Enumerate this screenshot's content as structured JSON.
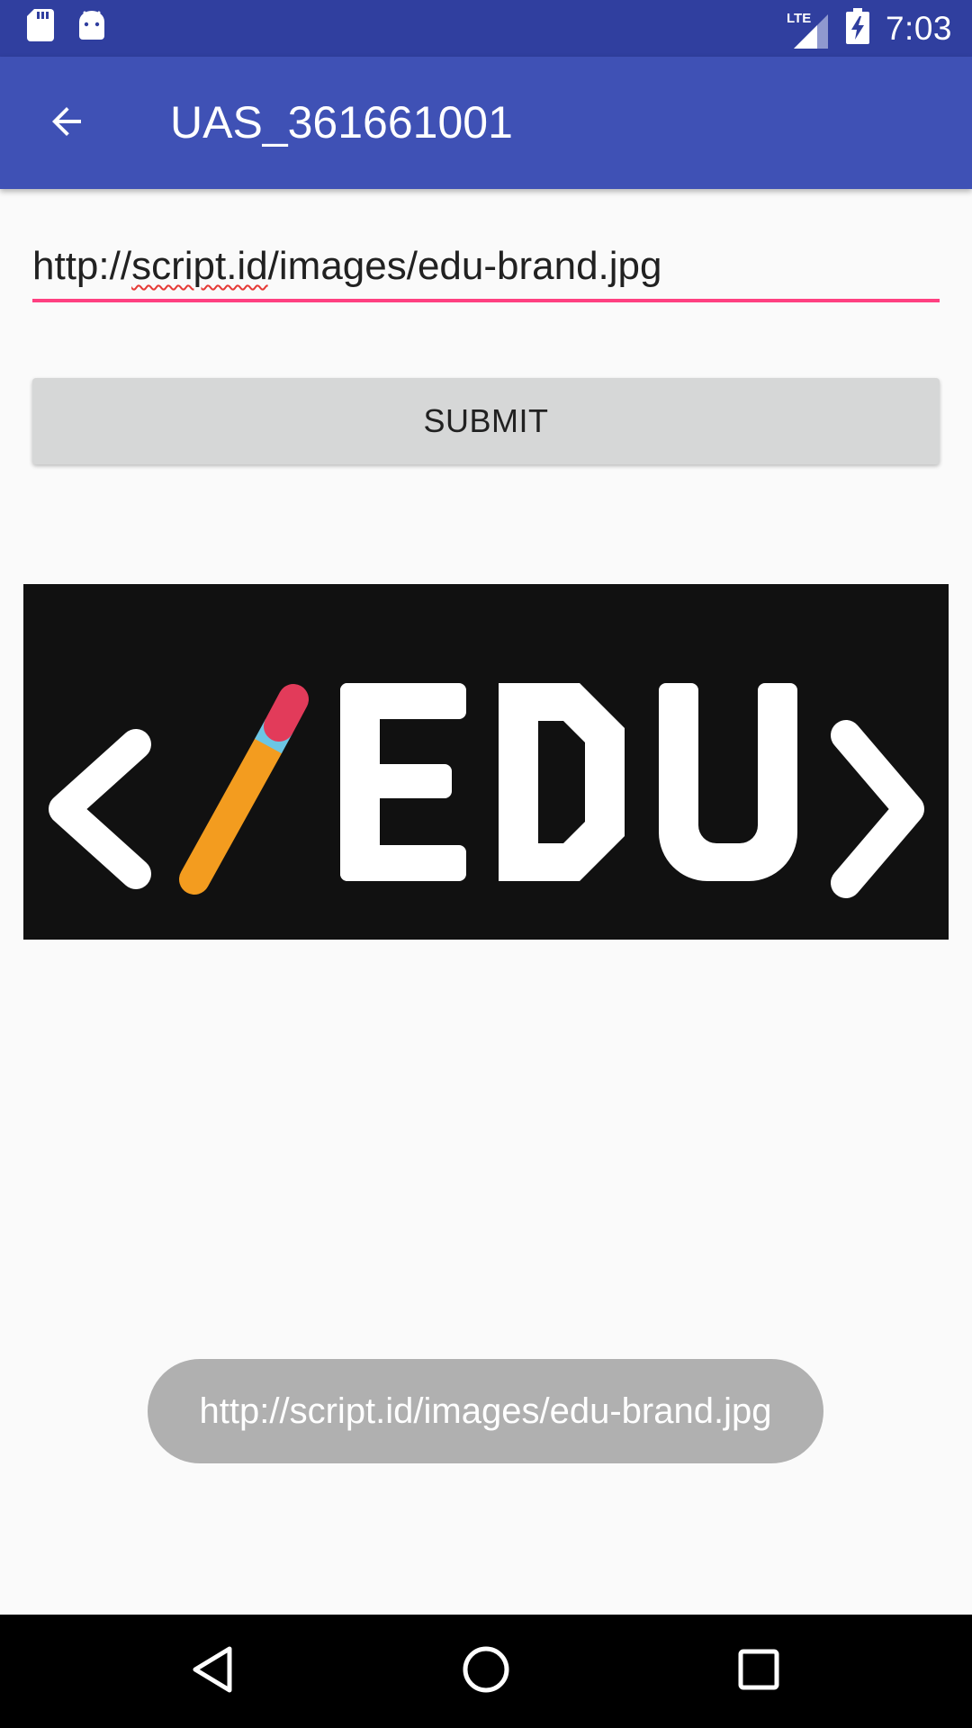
{
  "status_bar": {
    "time": "7:03",
    "network": "LTE",
    "icons": [
      "sd-card-icon",
      "android-icon",
      "signal-icon",
      "battery-charging-icon"
    ]
  },
  "app_bar": {
    "title": "UAS_361661001",
    "back_icon": "arrow-back-icon"
  },
  "form": {
    "url_value_parts": [
      "http://",
      "script.id",
      "/images/edu-brand.jpg"
    ],
    "submit_label": "SUBMIT"
  },
  "image": {
    "alt": "</EDU> brand logo",
    "logo_text": "</EDU>",
    "colors": {
      "background": "#111111",
      "text": "#ffffff",
      "pencil_body": "#f39c1f",
      "pencil_band": "#6cc6e4",
      "pencil_eraser": "#e23b5a"
    }
  },
  "toast": {
    "message": "http://script.id/images/edu-brand.jpg"
  },
  "nav_bar": {
    "buttons": [
      "back-icon",
      "home-icon",
      "recents-icon"
    ]
  },
  "colors": {
    "primary": "#3f51b5",
    "primary_dark": "#303f9f",
    "accent": "#ff4081"
  }
}
